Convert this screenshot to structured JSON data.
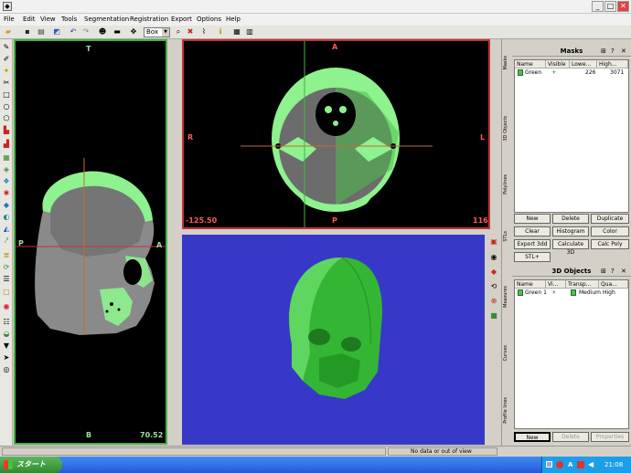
{
  "menu": [
    "File",
    "Edit",
    "View",
    "Tools",
    "Segmentation",
    "Registration",
    "Export",
    "Options",
    "Help"
  ],
  "toolbar": {
    "view_select": "Box"
  },
  "views": {
    "sagittal": {
      "top": "T",
      "bottom": "B",
      "left": "P",
      "right": "A",
      "value": "70.52"
    },
    "axial": {
      "top": "A",
      "bottom": "P",
      "left": "R",
      "right": "L",
      "value_left": "-125.50",
      "value_right": "116"
    }
  },
  "side_tabs_top": [
    "Masks",
    "3D Objects",
    "Polylines",
    "STLs"
  ],
  "side_tabs_bottom": [
    "Measures",
    "Curves",
    "Profile lines"
  ],
  "masks": {
    "title": "Masks",
    "columns": [
      "Name",
      "Visible",
      "Lowe...",
      "High..."
    ],
    "rows": [
      {
        "name": "Green",
        "visible": "☀",
        "low": "226",
        "high": "3071"
      }
    ],
    "buttons": [
      "New",
      "Delete",
      "Duplicate",
      "Clear",
      "Histogram",
      "Color",
      "Export 3dd",
      "Calculate 3D",
      "Calc Poly",
      "STL+"
    ]
  },
  "objects3d": {
    "title": "3D Objects",
    "columns": [
      "Name",
      "Vi...",
      "Transp...",
      "Qua..."
    ],
    "rows": [
      {
        "name": "Green 1",
        "visible": "☀",
        "transp": "Medium",
        "quality": "High"
      }
    ],
    "buttons": [
      "New",
      "Delete",
      "Properties"
    ]
  },
  "status": "No data or out of view",
  "taskbar": {
    "start": "スタート",
    "tray": "A",
    "time": "21:08"
  },
  "colors": {
    "mask": "#63d863",
    "viewport_3d_bg": "#3838c8",
    "active_border": "#c83232",
    "sagittal_border": "#43b443"
  }
}
